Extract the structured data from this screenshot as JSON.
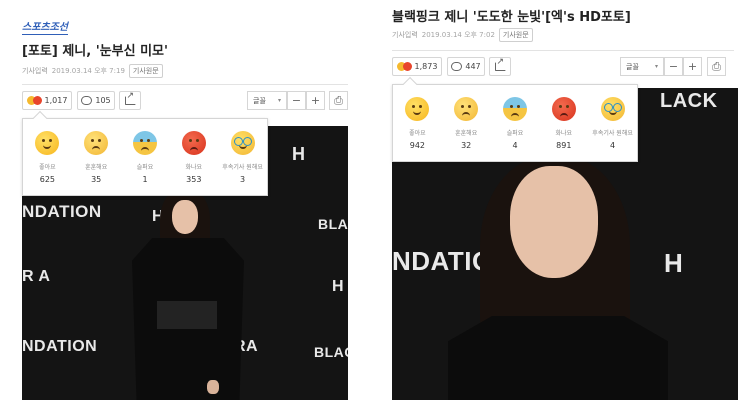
{
  "left": {
    "logo": "스포츠조선",
    "headline": "[포토] 제니, '눈부신 미모'",
    "meta_label": "기사입력",
    "timestamp": "2019.03.14 오후 7:19",
    "original_button": "기사원문",
    "reaction_total": "1,017",
    "comment_count": "105",
    "font_select": "글꼴",
    "reactions": [
      {
        "label": "좋아요",
        "count": "625"
      },
      {
        "label": "훈훈해요",
        "count": "35"
      },
      {
        "label": "슬퍼요",
        "count": "1"
      },
      {
        "label": "화나요",
        "count": "353"
      },
      {
        "label": "후속기사 원해요",
        "count": "3"
      }
    ],
    "photo_text": [
      "H",
      "BLAC",
      "NDATION",
      "HERA",
      "R  A",
      "H",
      "NDATION",
      "RA",
      "BLAC"
    ]
  },
  "right": {
    "headline": "블랙핑크 제니 '도도한 눈빛'[엑's HD포토]",
    "meta_label": "기사입력",
    "timestamp": "2019.03.14 오후 7:02",
    "original_button": "기사원문",
    "reaction_total": "1,873",
    "comment_count": "447",
    "font_select": "글꼴",
    "reactions": [
      {
        "label": "좋아요",
        "count": "942"
      },
      {
        "label": "훈훈해요",
        "count": "32"
      },
      {
        "label": "슬퍼요",
        "count": "4"
      },
      {
        "label": "화나요",
        "count": "891"
      },
      {
        "label": "후속기사 원해요",
        "count": "4"
      }
    ],
    "photo_text": [
      "LACK",
      "NDATION",
      "H"
    ]
  },
  "icons": {
    "minus": "−",
    "plus": "+",
    "print": "⎙",
    "share": "share-icon",
    "comment": "comment-icon",
    "chevron": "▾"
  },
  "colors": {
    "logo": "#2f5fb8",
    "popup_border": "#d5d5d5"
  }
}
